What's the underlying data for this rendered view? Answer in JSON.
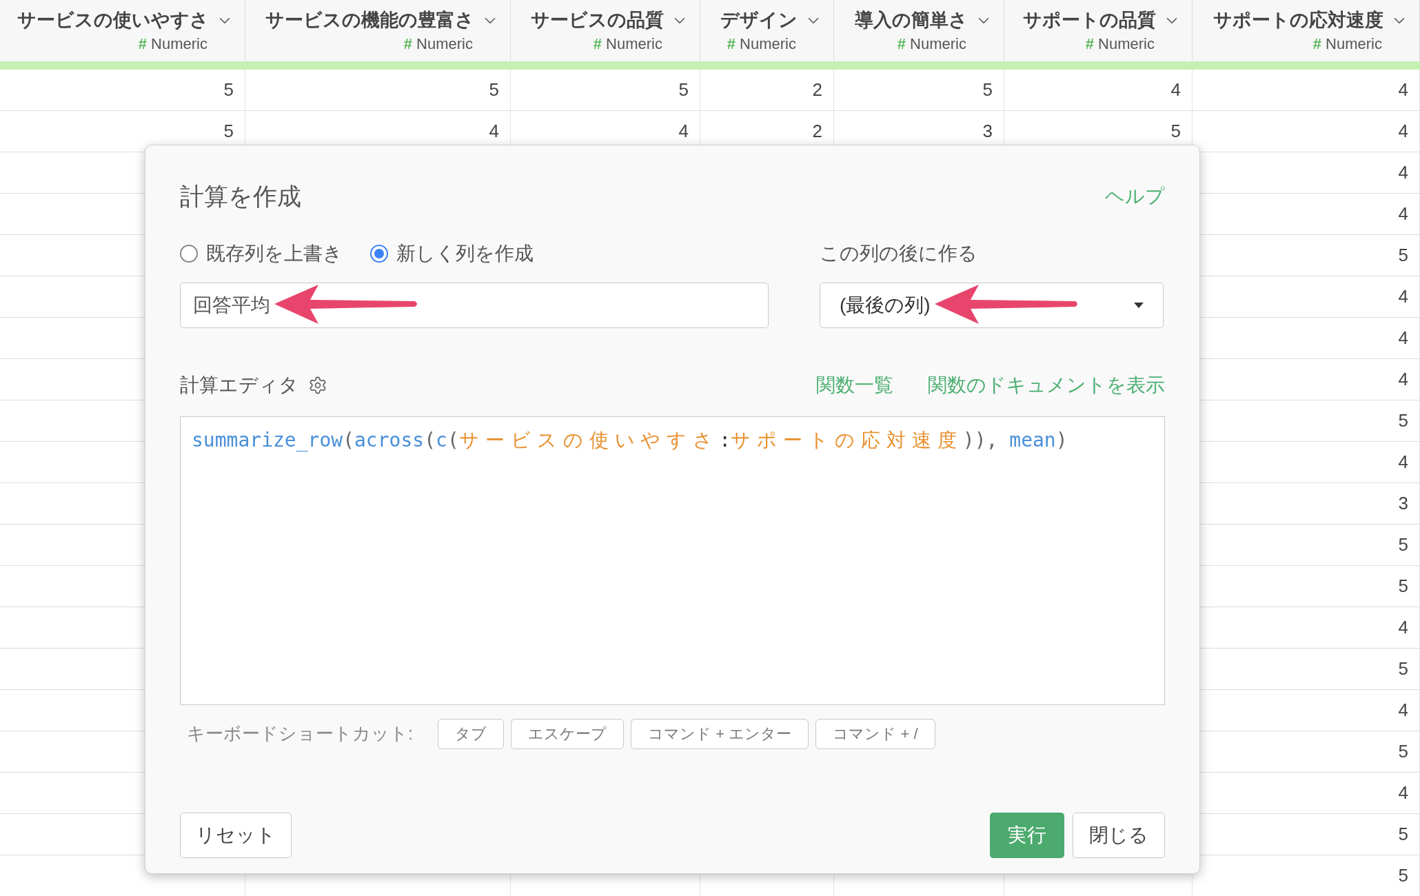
{
  "table": {
    "columns": [
      {
        "title": "サービスの使いやすさ",
        "type_mark": "#",
        "type": "Numeric"
      },
      {
        "title": "サービスの機能の豊富さ",
        "type_mark": "#",
        "type": "Numeric"
      },
      {
        "title": "サービスの品質",
        "type_mark": "#",
        "type": "Numeric"
      },
      {
        "title": "デザイン",
        "type_mark": "#",
        "type": "Numeric"
      },
      {
        "title": "導入の簡単さ",
        "type_mark": "#",
        "type": "Numeric"
      },
      {
        "title": "サポートの品質",
        "type_mark": "#",
        "type": "Numeric"
      },
      {
        "title": "サポートの応対速度",
        "type_mark": "#",
        "type": "Numeric"
      }
    ],
    "rows": [
      {
        "cells": [
          "5",
          "5",
          "5",
          "2",
          "5",
          "4",
          "4"
        ]
      },
      {
        "cells": [
          "5",
          "4",
          "4",
          "2",
          "3",
          "5",
          "4"
        ]
      },
      {
        "cells": [
          null,
          null,
          null,
          null,
          null,
          null,
          "4"
        ]
      },
      {
        "cells": [
          null,
          null,
          null,
          null,
          null,
          null,
          "4"
        ]
      },
      {
        "cells": [
          null,
          null,
          null,
          null,
          null,
          null,
          "5"
        ]
      },
      {
        "cells": [
          null,
          null,
          null,
          null,
          null,
          null,
          "4"
        ]
      },
      {
        "cells": [
          null,
          null,
          null,
          null,
          null,
          null,
          "4"
        ]
      },
      {
        "cells": [
          null,
          null,
          null,
          null,
          null,
          null,
          "4"
        ]
      },
      {
        "cells": [
          null,
          null,
          null,
          null,
          null,
          null,
          "5"
        ]
      },
      {
        "cells": [
          null,
          null,
          null,
          null,
          null,
          null,
          "4"
        ]
      },
      {
        "cells": [
          null,
          null,
          null,
          null,
          null,
          null,
          "3"
        ]
      },
      {
        "cells": [
          null,
          null,
          null,
          null,
          null,
          null,
          "5"
        ]
      },
      {
        "cells": [
          null,
          null,
          null,
          null,
          null,
          null,
          "5"
        ]
      },
      {
        "cells": [
          null,
          null,
          null,
          null,
          null,
          null,
          "4"
        ]
      },
      {
        "cells": [
          null,
          null,
          null,
          null,
          null,
          null,
          "5"
        ]
      },
      {
        "cells": [
          null,
          null,
          null,
          null,
          null,
          null,
          "4"
        ]
      },
      {
        "cells": [
          null,
          null,
          null,
          null,
          null,
          null,
          "5"
        ]
      },
      {
        "cells": [
          null,
          null,
          null,
          null,
          null,
          null,
          "4"
        ]
      },
      {
        "cells": [
          null,
          null,
          null,
          null,
          null,
          null,
          "5"
        ]
      },
      {
        "cells": [
          null,
          null,
          null,
          null,
          null,
          null,
          "5"
        ]
      }
    ]
  },
  "dialog": {
    "title": "計算を作成",
    "help_link": "ヘルプ",
    "mode_options": [
      {
        "label": "既存列を上書き",
        "selected": false
      },
      {
        "label": "新しく列を作成",
        "selected": true
      }
    ],
    "position_label": "この列の後に作る",
    "column_name": {
      "value": "回答平均"
    },
    "position_select": {
      "value": "(最後の列)"
    },
    "editor_label": "計算エディタ",
    "links": [
      "関数一覧",
      "関数のドキュメントを表示"
    ],
    "code_tokens": [
      {
        "text": "summarize_row",
        "kind": "function"
      },
      {
        "text": "(",
        "kind": "punct"
      },
      {
        "text": "across",
        "kind": "function"
      },
      {
        "text": "(",
        "kind": "punct"
      },
      {
        "text": "c",
        "kind": "function"
      },
      {
        "text": "(",
        "kind": "punct"
      },
      {
        "text": "サービスの使いやすさ",
        "kind": "column"
      },
      {
        "text": ":",
        "kind": "operator"
      },
      {
        "text": "サポートの応対速度",
        "kind": "column"
      },
      {
        "text": ")), ",
        "kind": "punct"
      },
      {
        "text": "mean",
        "kind": "function"
      },
      {
        "text": ")",
        "kind": "punct"
      }
    ],
    "shortcuts_label": "キーボードショートカット:",
    "shortcuts": [
      "タブ",
      "エスケープ",
      "コマンド + エンター",
      "コマンド + /"
    ],
    "buttons": {
      "reset": "リセット",
      "run": "実行",
      "close": "閉じる"
    }
  }
}
